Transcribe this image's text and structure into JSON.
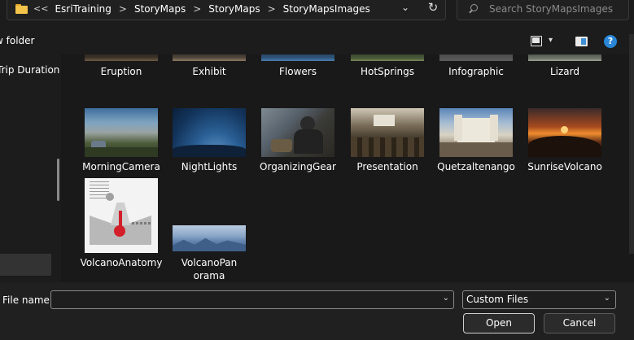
{
  "address": {
    "more_glyph": "<<",
    "crumbs": [
      "EsriTraining",
      "StoryMaps",
      "StoryMaps",
      "StoryMapsImages"
    ],
    "separator": ">",
    "dropdown_glyph": "⌄",
    "refresh_glyph": "↻"
  },
  "search": {
    "placeholder": "Search StoryMapsImages"
  },
  "commands": {
    "new_folder": "w folder",
    "view_dropdown_glyph": "▾",
    "help_glyph": "?"
  },
  "nav": {
    "trip_item": "Trip Duration"
  },
  "files": [
    {
      "name": "Eruption"
    },
    {
      "name": "Exhibit"
    },
    {
      "name": "Flowers"
    },
    {
      "name": "HotSprings"
    },
    {
      "name": "Infographic"
    },
    {
      "name": "Lizard"
    },
    {
      "name": "MorningCamera"
    },
    {
      "name": "NightLights"
    },
    {
      "name": "OrganizingGear"
    },
    {
      "name": "Presentation"
    },
    {
      "name": "Quetzaltenango"
    },
    {
      "name": "SunriseVolcano"
    },
    {
      "name": "VolcanoAnatomy"
    },
    {
      "name": "VolcanoPanorama"
    }
  ],
  "bottom": {
    "file_name_label": "File name:",
    "file_name_value": "",
    "filter_value": "Custom Files",
    "dropdown_glyph": "⌄",
    "open_label": "Open",
    "cancel_label": "Cancel"
  },
  "colors": {
    "background": "#191919",
    "folder": "#f4c34a",
    "help": "#2a86d6",
    "selection": "#333333"
  }
}
